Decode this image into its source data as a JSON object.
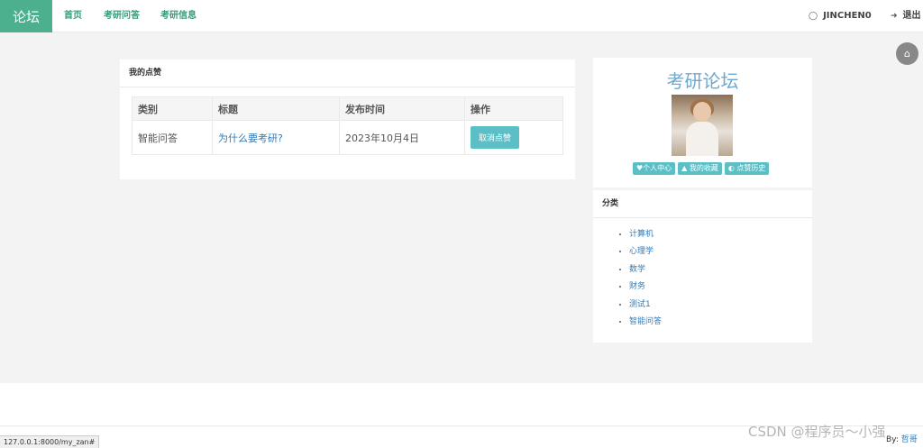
{
  "nav": {
    "brand": "论坛",
    "links": [
      "首页",
      "考研问答",
      "考研信息"
    ],
    "user": "JINCHEN0",
    "logout": "退出"
  },
  "likes": {
    "title": "我的点赞",
    "headers": [
      "类别",
      "标题",
      "发布时间",
      "操作"
    ],
    "rows": [
      {
        "category": "智能问答",
        "title": "为什么要考研?",
        "date": "2023年10月4日",
        "action": "取消点赞"
      }
    ]
  },
  "profile": {
    "forum_title": "考研论坛",
    "buttons": [
      "个人中心",
      "我的收藏",
      "点赞历史"
    ]
  },
  "categories": {
    "title": "分类",
    "items": [
      "计算机",
      "心理学",
      "数学",
      "财务",
      "测试1",
      "智能问答"
    ]
  },
  "status_bar": {
    "url": "127.0.0.1:8000/my_zan#"
  },
  "footer": {
    "by": "By:",
    "by_link": "哲哥"
  },
  "watermark": "CSDN @程序员～小强",
  "colors": {
    "brand": "#4caf8e",
    "accent": "#5bbfc5",
    "link": "#337ab7"
  },
  "icons": {
    "home": "home-icon",
    "user": "user-icon",
    "logout": "logout-icon"
  }
}
